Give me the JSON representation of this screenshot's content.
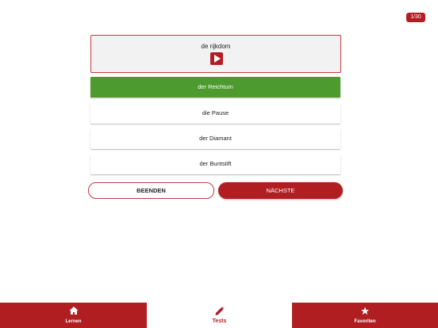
{
  "progress": "1/30",
  "question": {
    "word": "de rijkdom"
  },
  "answers": [
    {
      "label": "der Reichtum",
      "state": "correct"
    },
    {
      "label": "die Pause",
      "state": "normal"
    },
    {
      "label": "der Diamant",
      "state": "normal"
    },
    {
      "label": "der Buntstift",
      "state": "normal"
    }
  ],
  "buttons": {
    "end_label": "BEENDEN",
    "next_label": "NÄCHSTE"
  },
  "tabs": [
    {
      "label": "Lernen",
      "icon": "home-icon",
      "active": false
    },
    {
      "label": "Tests",
      "icon": "pencil-icon",
      "active": true
    },
    {
      "label": "Favoriten",
      "icon": "star-icon",
      "active": false
    }
  ],
  "colors": {
    "accent": "#b01e22",
    "correct": "#4d9b2f"
  }
}
